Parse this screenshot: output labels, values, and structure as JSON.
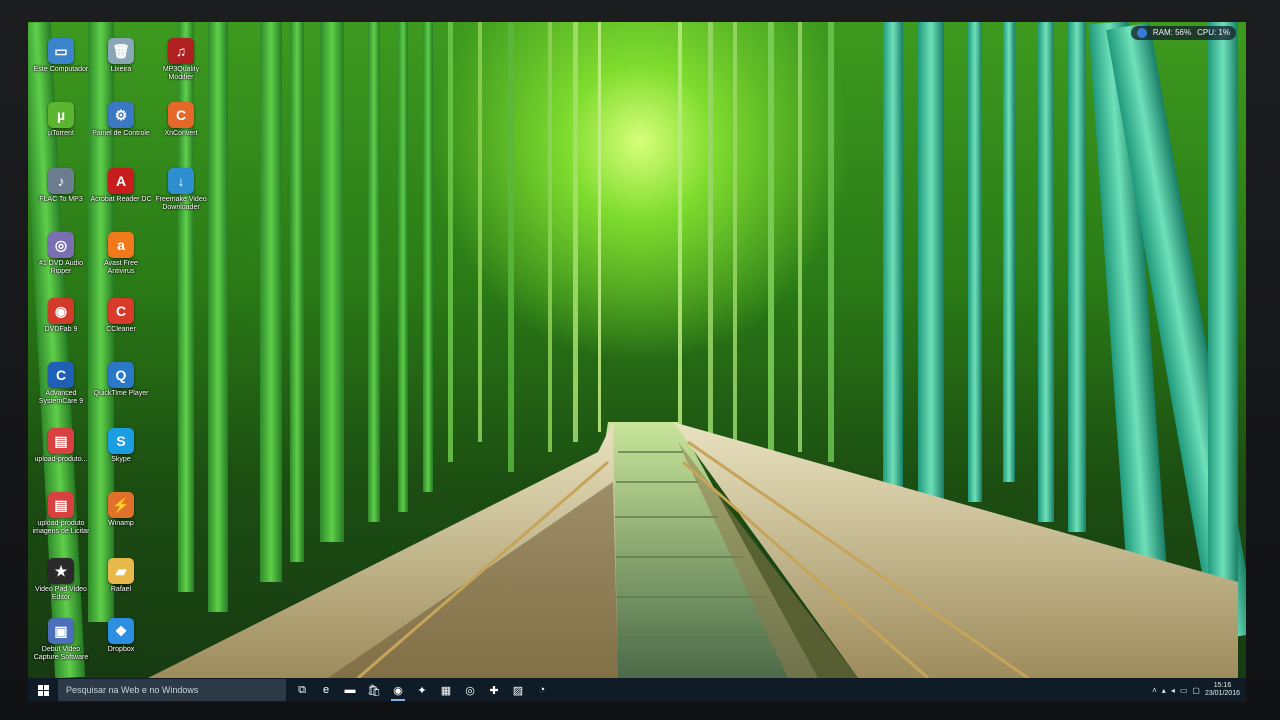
{
  "colors": {
    "taskbar": "#0f1c28",
    "search": "#2c3a47",
    "accent": "#7fb2e5"
  },
  "hud": {
    "ram": "RAM: 56%",
    "cpu": "CPU: 1%"
  },
  "desktop": {
    "icons": [
      {
        "label": "Este Computador",
        "icon": "computer-icon",
        "color": "#3a85c9",
        "glyph": "▭"
      },
      {
        "label": "Lixeira",
        "icon": "recycle-bin-icon",
        "color": "#8aa7b6",
        "glyph": "🗑"
      },
      {
        "label": "MP3Quality Modifier",
        "icon": "mp3quality-icon",
        "color": "#b02020",
        "glyph": "♫"
      },
      {
        "label": "µTorrent",
        "icon": "utorrent-icon",
        "color": "#5cb531",
        "glyph": "µ"
      },
      {
        "label": "Painel de Controle",
        "icon": "control-panel-icon",
        "color": "#3b79c4",
        "glyph": "⚙"
      },
      {
        "label": "XnConvert",
        "icon": "xnconvert-icon",
        "color": "#e4682a",
        "glyph": "C"
      },
      {
        "label": "FLAC To MP3",
        "icon": "flac-to-mp3-icon",
        "color": "#6d7d90",
        "glyph": "♪"
      },
      {
        "label": "Acrobat Reader DC",
        "icon": "acrobat-reader-icon",
        "color": "#c91d1d",
        "glyph": "A"
      },
      {
        "label": "Freemake Video Downloader",
        "icon": "freemake-icon",
        "color": "#2e8fd0",
        "glyph": "↓"
      },
      {
        "label": "#1 DVD Audio Ripper",
        "icon": "dvd-audio-ripper-icon",
        "color": "#7a6fb0",
        "glyph": "◎"
      },
      {
        "label": "Avast Free Antivirus",
        "icon": "avast-icon",
        "color": "#f07a1b",
        "glyph": "a"
      },
      {
        "label": "DVDFab 9",
        "icon": "dvdfab-icon",
        "color": "#d23a2a",
        "glyph": "◉"
      },
      {
        "label": "CCleaner",
        "icon": "ccleaner-icon",
        "color": "#d83b2a",
        "glyph": "C"
      },
      {
        "label": "Advanced SystemCare 9",
        "icon": "advanced-systemcare-icon",
        "color": "#1f5fb6",
        "glyph": "C"
      },
      {
        "label": "QuickTime Player",
        "icon": "quicktime-icon",
        "color": "#2a78c8",
        "glyph": "Q"
      },
      {
        "label": "upload-produto...",
        "icon": "pdf-file-icon",
        "color": "#d94141",
        "glyph": "▤"
      },
      {
        "label": "Skype",
        "icon": "skype-icon",
        "color": "#1b9de2",
        "glyph": "S"
      },
      {
        "label": "upload-produto imagens de Licitar",
        "icon": "pdf-file-icon",
        "color": "#d94141",
        "glyph": "▤"
      },
      {
        "label": "Winamp",
        "icon": "winamp-icon",
        "color": "#e0712a",
        "glyph": "⚡"
      },
      {
        "label": "Video Pad Video Editor",
        "icon": "videopad-icon",
        "color": "#2a2a2a",
        "glyph": "★"
      },
      {
        "label": "Rafael",
        "icon": "folder-icon",
        "color": "#e8b84a",
        "glyph": "▰"
      },
      {
        "label": "Debut Video Capture Software",
        "icon": "debut-icon",
        "color": "#4b6fb8",
        "glyph": "▣"
      },
      {
        "label": "Dropbox",
        "icon": "dropbox-icon",
        "color": "#2c8fe2",
        "glyph": "❖"
      }
    ]
  },
  "taskbar": {
    "start_icon": "windows-logo-icon",
    "search_placeholder": "Pesquisar na Web e no Windows",
    "apps": [
      {
        "icon": "task-view-icon",
        "glyph": "⧉"
      },
      {
        "icon": "edge-icon",
        "glyph": "e"
      },
      {
        "icon": "file-explorer-icon",
        "glyph": "▬"
      },
      {
        "icon": "store-icon",
        "glyph": "🛍"
      },
      {
        "icon": "chrome-icon",
        "glyph": "◉"
      },
      {
        "icon": "app-icon",
        "glyph": "✦"
      },
      {
        "icon": "calculator-icon",
        "glyph": "▦"
      },
      {
        "icon": "media-icon",
        "glyph": "◎"
      },
      {
        "icon": "tool-icon",
        "glyph": "✚"
      },
      {
        "icon": "photos-icon",
        "glyph": "▨"
      },
      {
        "icon": "advanced-systemcare-icon",
        "glyph": "◔"
      }
    ],
    "tray": {
      "time": "15:16",
      "date": "23/01/2016"
    }
  }
}
